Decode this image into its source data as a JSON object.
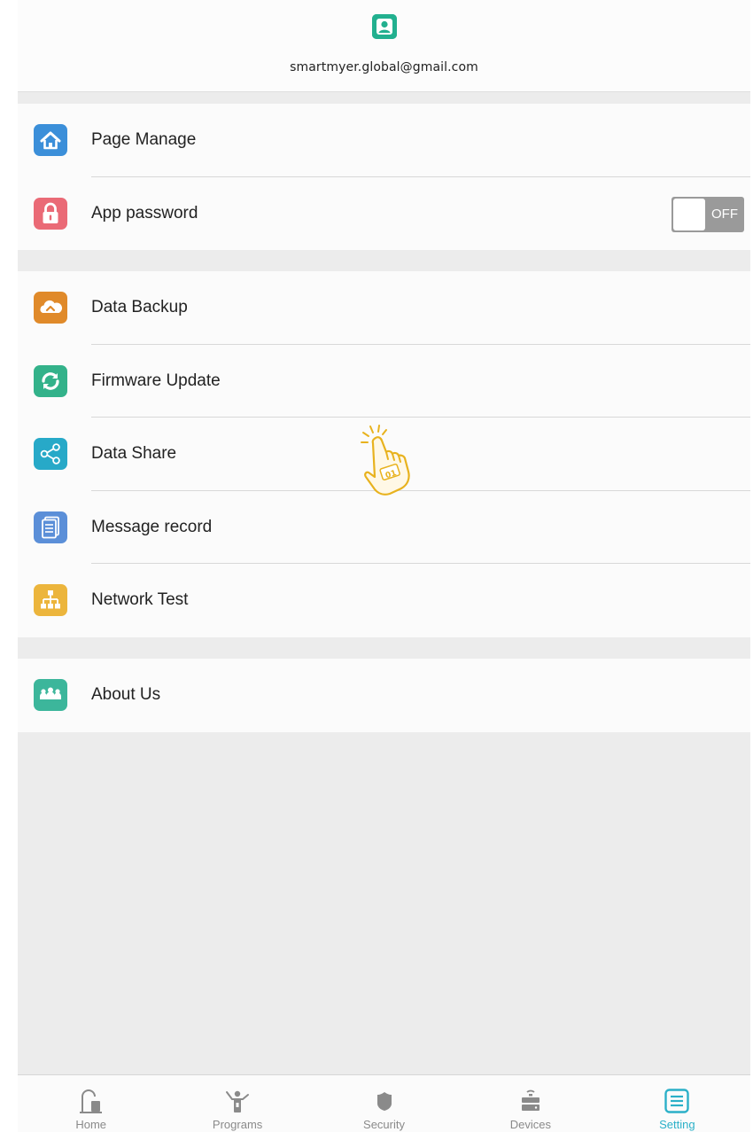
{
  "header": {
    "avatar_icon": "user-avatar-icon",
    "email": "smartmyer.global@gmail.com"
  },
  "groups": [
    {
      "items": [
        {
          "label": "Page Manage",
          "icon": "home-icon",
          "color": "#3b8fd9"
        },
        {
          "label": "App password",
          "icon": "lock-icon",
          "color": "#ea6a76",
          "toggle": {
            "state": "OFF"
          }
        }
      ]
    },
    {
      "items": [
        {
          "label": "Data Backup",
          "icon": "cloud-backup-icon",
          "color": "#e08a2a"
        },
        {
          "label": "Firmware Update",
          "icon": "refresh-icon",
          "color": "#33b28a"
        },
        {
          "label": "Data Share",
          "icon": "share-icon",
          "color": "#27a9c8"
        },
        {
          "label": "Message record",
          "icon": "document-icon",
          "color": "#5b8fd8"
        },
        {
          "label": "Network Test",
          "icon": "network-icon",
          "color": "#ecb53c"
        }
      ]
    },
    {
      "items": [
        {
          "label": "About Us",
          "icon": "team-icon",
          "color": "#3cb69b"
        }
      ]
    }
  ],
  "bottom_nav": {
    "items": [
      {
        "label": "Home",
        "icon": "home-nav-icon",
        "active": false
      },
      {
        "label": "Programs",
        "icon": "programs-icon",
        "active": false
      },
      {
        "label": "Security",
        "icon": "security-shield-icon",
        "active": false
      },
      {
        "label": "Devices",
        "icon": "devices-icon",
        "active": false
      },
      {
        "label": "Setting",
        "icon": "setting-icon",
        "active": true
      }
    ],
    "active_color": "#2bb0c8",
    "inactive_color": "#8a8a8a"
  },
  "decoration": {
    "pointer_icon": "tap-pointer-icon",
    "pointer_color": "#e8b21e"
  }
}
